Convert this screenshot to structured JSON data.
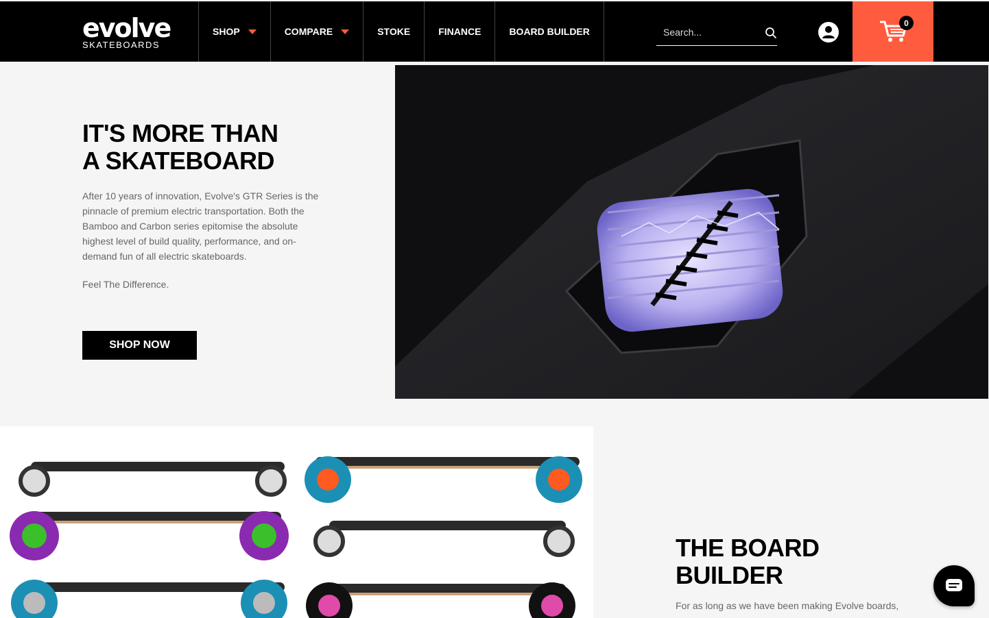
{
  "header": {
    "logo_main": "evolve",
    "logo_sub": "SKATEBOARDS",
    "nav": [
      {
        "label": "SHOP",
        "dropdown": true
      },
      {
        "label": "COMPARE",
        "dropdown": true
      },
      {
        "label": "STOKE",
        "dropdown": false
      },
      {
        "label": "FINANCE",
        "dropdown": false
      },
      {
        "label": "BOARD BUILDER",
        "dropdown": false
      }
    ],
    "search_placeholder": "Search...",
    "cart_count": "0"
  },
  "hero": {
    "title": "IT'S MORE THAN\nA SKATEBOARD",
    "body": "After 10 years of innovation, Evolve's GTR Series is the pinnacle of premium electric transportation. Both the Bamboo and Carbon series epitomise the absolute highest level of build quality, performance, and on-demand fun of all electric skateboards.",
    "tagline": "Feel The Difference.",
    "cta": "SHOP NOW"
  },
  "board_builder": {
    "title": "THE BOARD\nBUILDER",
    "body": "For as long as we have been making Evolve boards,"
  },
  "colors": {
    "accent": "#ff5b3f",
    "header_bg": "#000000",
    "page_bg": "#f5f5f5"
  },
  "icons": {
    "search": "search-icon",
    "account": "account-icon",
    "cart": "cart-icon",
    "chat": "chat-icon"
  }
}
